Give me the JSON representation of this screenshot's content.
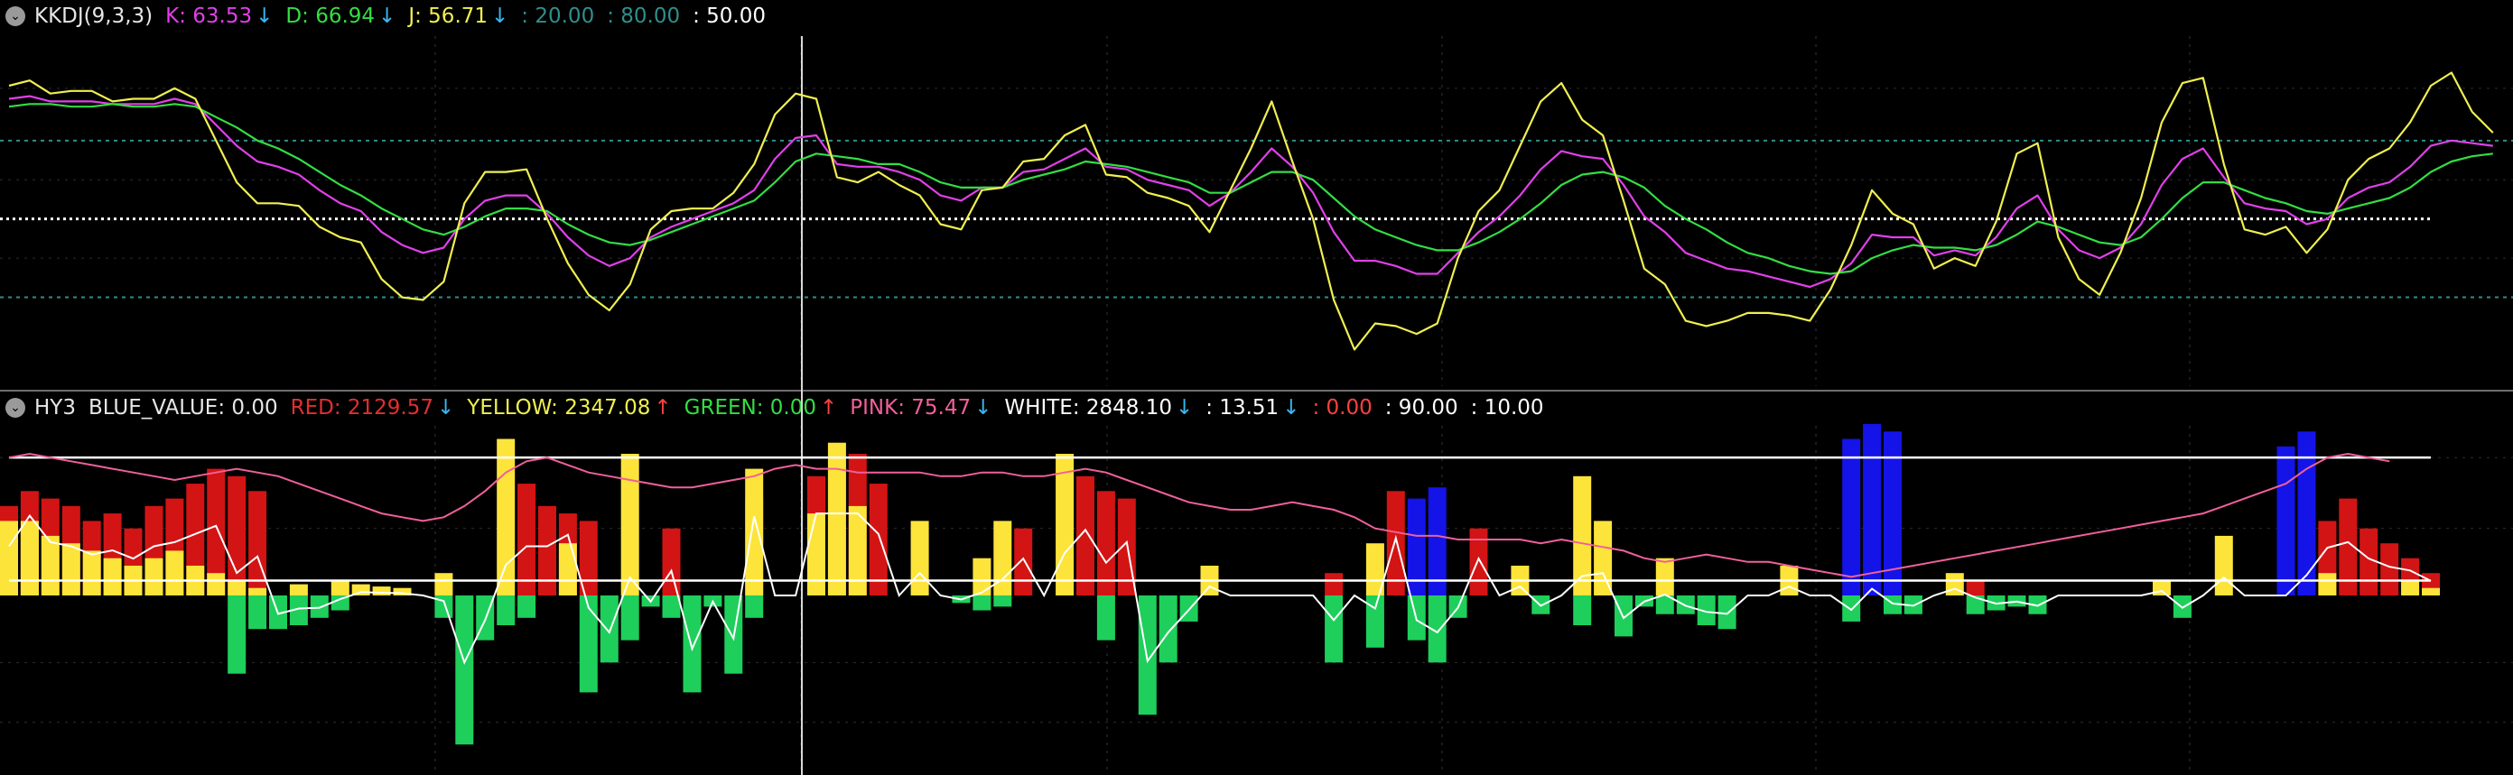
{
  "colors": {
    "k": "#e040ea",
    "d": "#33dd44",
    "j": "#f0ef50",
    "red": "#d31414",
    "yellow": "#fde43a",
    "green": "#1ecf5b",
    "blue": "#1414e8",
    "pink": "#f0609a",
    "white": "#ffffff",
    "teal": "#2f8f8c",
    "arrow_down": "#39b7ef",
    "arrow_up": "#ff4040"
  },
  "panel_top": {
    "title": "KKDJ(9,3,3)",
    "k_label": "K: 63.53",
    "k_dir": "↓",
    "d_label": "D: 66.94",
    "d_dir": "↓",
    "j_label": "J: 56.71",
    "j_dir": "↓",
    "level_low": ": 20.00",
    "level_high": ": 80.00",
    "level_mid": ": 50.00"
  },
  "panel_bottom": {
    "title": "HY3",
    "blue_label": "BLUE_VALUE: 0.00",
    "red_label": "RED: 2129.57",
    "red_dir": "↓",
    "yellow_label": "YELLOW: 2347.08",
    "yellow_dir": "↑",
    "green_label": "GREEN: 0.00",
    "green_dir": "↑",
    "pink_label": "PINK: 75.47",
    "pink_dir": "↓",
    "white_label": "WHITE: 2848.10",
    "white_dir": "↓",
    "v1_label": ": 13.51",
    "v1_dir": "↓",
    "v2_label": ": 0.00",
    "v3_label": ": 90.00",
    "v4_label": ": 10.00"
  },
  "chart_data": [
    {
      "type": "line",
      "title": "KKDJ(9,3,3)",
      "ylim": [
        -14,
        120
      ],
      "hlines": [
        {
          "value": 80,
          "style": "teal-dashed"
        },
        {
          "value": 50,
          "style": "white-dotted"
        },
        {
          "value": 20,
          "style": "teal-dashed"
        }
      ],
      "x_count": 118,
      "series": [
        {
          "name": "K",
          "color_key": "k",
          "values": [
            96,
            97,
            95,
            95,
            95,
            94,
            94,
            94,
            96,
            94,
            86,
            78,
            72,
            70,
            67,
            61,
            56,
            53,
            45,
            40,
            37,
            39,
            50,
            57,
            59,
            59,
            52,
            43,
            36,
            32,
            35,
            43,
            47,
            50,
            53,
            56,
            61,
            73,
            81,
            82,
            71,
            70,
            70,
            68,
            65,
            59,
            57,
            62,
            62,
            68,
            69,
            73,
            77,
            70,
            69,
            65,
            63,
            61,
            55,
            60,
            68,
            77,
            70,
            60,
            45,
            34,
            34,
            32,
            29,
            29,
            37,
            45,
            51,
            59,
            69,
            76,
            74,
            73,
            63,
            51,
            45,
            37,
            34,
            31,
            30,
            28,
            26,
            24,
            27,
            33,
            44,
            43,
            43,
            36,
            38,
            36,
            43,
            54,
            59,
            46,
            38,
            35,
            39,
            48,
            63,
            73,
            77,
            66,
            56,
            54,
            53,
            48,
            50,
            58,
            62,
            64,
            70,
            78,
            80,
            79,
            78
          ]
        },
        {
          "name": "D",
          "color_key": "d",
          "values": [
            93,
            94,
            94,
            93,
            93,
            94,
            93,
            93,
            94,
            93,
            89,
            85,
            80,
            77,
            73,
            68,
            63,
            59,
            54,
            50,
            46,
            44,
            47,
            51,
            54,
            54,
            53,
            48,
            44,
            41,
            40,
            42,
            45,
            48,
            51,
            54,
            57,
            64,
            72,
            75,
            74,
            73,
            71,
            71,
            68,
            64,
            62,
            62,
            62,
            65,
            67,
            69,
            72,
            71,
            70,
            68,
            66,
            64,
            60,
            60,
            64,
            68,
            68,
            65,
            58,
            51,
            46,
            43,
            40,
            38,
            38,
            41,
            45,
            50,
            56,
            63,
            67,
            68,
            66,
            62,
            55,
            50,
            46,
            41,
            37,
            35,
            32,
            30,
            29,
            30,
            35,
            38,
            40,
            39,
            39,
            38,
            40,
            44,
            49,
            47,
            44,
            41,
            40,
            43,
            50,
            58,
            64,
            64,
            61,
            58,
            56,
            53,
            52,
            54,
            56,
            58,
            62,
            68,
            72,
            74,
            75
          ]
        },
        {
          "name": "J",
          "color_key": "j",
          "values": [
            101,
            103,
            98,
            99,
            99,
            95,
            96,
            96,
            100,
            96,
            80,
            64,
            56,
            56,
            55,
            47,
            43,
            41,
            27,
            20,
            19,
            26,
            56,
            68,
            68,
            69,
            50,
            33,
            21,
            15,
            25,
            46,
            53,
            54,
            54,
            60,
            71,
            90,
            98,
            96,
            66,
            64,
            68,
            63,
            59,
            48,
            46,
            61,
            62,
            72,
            73,
            82,
            86,
            67,
            66,
            60,
            58,
            55,
            45,
            61,
            77,
            95,
            72,
            50,
            19,
            0,
            10,
            9,
            6,
            10,
            35,
            53,
            61,
            78,
            95,
            102,
            88,
            82,
            57,
            31,
            25,
            11,
            9,
            11,
            14,
            14,
            13,
            11,
            23,
            40,
            61,
            52,
            48,
            31,
            35,
            32,
            49,
            75,
            79,
            43,
            27,
            21,
            37,
            58,
            87,
            102,
            104,
            71,
            46,
            44,
            47,
            37,
            46,
            65,
            73,
            77,
            87,
            101,
            106,
            91,
            83
          ]
        }
      ]
    },
    {
      "type": "bar",
      "title": "HY3",
      "ylim": [
        -2300,
        2300
      ],
      "hlines": [
        {
          "value": 1850,
          "color_key": "white"
        },
        {
          "value": 200,
          "color_key": "white"
        }
      ],
      "x_count": 118,
      "red_values": [
        1200,
        1400,
        1300,
        1200,
        1000,
        1100,
        900,
        1200,
        1300,
        1500,
        1700,
        1600,
        1400,
        0,
        0,
        0,
        0,
        0,
        0,
        0,
        0,
        0,
        0,
        0,
        0,
        1500,
        1200,
        1100,
        1000,
        0,
        0,
        0,
        900,
        0,
        0,
        0,
        1300,
        0,
        0,
        1600,
        1900,
        1900,
        1500,
        0,
        0,
        0,
        0,
        0,
        0,
        900,
        0,
        0,
        1600,
        1400,
        1300,
        0,
        0,
        0,
        0,
        0,
        0,
        0,
        0,
        0,
        300,
        0,
        0,
        1400,
        0,
        0,
        0,
        900,
        0,
        0,
        0,
        0,
        0,
        0,
        0,
        0,
        0,
        0,
        0,
        0,
        0,
        0,
        0,
        0,
        0,
        0,
        0,
        0,
        0,
        0,
        0,
        200,
        0,
        0,
        0,
        0,
        0,
        0,
        0,
        0,
        0,
        0,
        0,
        0,
        0,
        0,
        0,
        500,
        1000,
        1300,
        900,
        700,
        500,
        300
      ],
      "yellow_values": [
        1000,
        900,
        800,
        700,
        600,
        500,
        400,
        500,
        600,
        400,
        300,
        200,
        100,
        0,
        0,
        0,
        0,
        0,
        0,
        0,
        0,
        0,
        0,
        0,
        0,
        0,
        0,
        0,
        0,
        0,
        0,
        0,
        0,
        0,
        0,
        0,
        0,
        0,
        0,
        0,
        0,
        0,
        0,
        0,
        0,
        0,
        0,
        0,
        0,
        0,
        0,
        0,
        0,
        0,
        0,
        0,
        0,
        0,
        0,
        0,
        0,
        0,
        0,
        0,
        0,
        0,
        0,
        0,
        0,
        0,
        0,
        0,
        0,
        0,
        0,
        0,
        0,
        0,
        0,
        0,
        0,
        0,
        0,
        0,
        0,
        0,
        0,
        0,
        0,
        0,
        0,
        0,
        0,
        0,
        0,
        0,
        0,
        0,
        0,
        0,
        0,
        0,
        0,
        0,
        0,
        0,
        0,
        0,
        0,
        0,
        0,
        0,
        0,
        0,
        0,
        0,
        0,
        0
      ],
      "yellow_bars": [
        0,
        1000,
        0,
        0,
        0,
        0,
        0,
        0,
        0,
        0,
        0,
        0,
        0,
        0,
        150,
        0,
        200,
        150,
        120,
        100,
        0,
        300,
        0,
        0,
        2100,
        0,
        0,
        700,
        0,
        0,
        1900,
        0,
        0,
        0,
        0,
        0,
        1700,
        0,
        0,
        1100,
        2050,
        1200,
        0,
        0,
        1000,
        0,
        0,
        500,
        1000,
        0,
        0,
        1900,
        0,
        0,
        0,
        0,
        0,
        0,
        400,
        0,
        0,
        0,
        0,
        0,
        0,
        0,
        700,
        0,
        0,
        0,
        0,
        0,
        0,
        400,
        0,
        0,
        1600,
        1000,
        0,
        0,
        500,
        0,
        0,
        0,
        0,
        0,
        400,
        0,
        0,
        0,
        300,
        100,
        0,
        0,
        300,
        0,
        0,
        0,
        0,
        0,
        0,
        0,
        0,
        0,
        200,
        0,
        0,
        800,
        0,
        0,
        0,
        0,
        300,
        0,
        0,
        0,
        200,
        100,
        0,
        0,
        0,
        0,
        250,
        200,
        100
      ],
      "green_values": [
        0,
        0,
        0,
        0,
        0,
        0,
        0,
        0,
        0,
        0,
        0,
        -1050,
        -450,
        -450,
        -400,
        -300,
        -200,
        0,
        0,
        0,
        0,
        -300,
        -2000,
        -600,
        -400,
        -300,
        0,
        0,
        -1300,
        -900,
        -600,
        -150,
        -300,
        -1300,
        -150,
        -1050,
        -300,
        0,
        0,
        0,
        0,
        0,
        0,
        0,
        0,
        0,
        -100,
        -200,
        -150,
        0,
        0,
        0,
        0,
        -600,
        0,
        -1600,
        -900,
        -350,
        0,
        0,
        0,
        0,
        0,
        0,
        -900,
        0,
        -700,
        0,
        -600,
        -900,
        -300,
        0,
        0,
        0,
        -250,
        0,
        -400,
        0,
        -550,
        -150,
        -250,
        -250,
        -400,
        -450,
        0,
        0,
        0,
        0,
        0,
        -350,
        0,
        -250,
        -250,
        0,
        0,
        -250,
        -200,
        -150,
        -250,
        0,
        0,
        0,
        0,
        0,
        0,
        -300
      ],
      "blue_values": [
        0,
        0,
        0,
        0,
        0,
        0,
        0,
        0,
        0,
        0,
        0,
        0,
        0,
        0,
        0,
        0,
        0,
        0,
        0,
        0,
        0,
        0,
        0,
        0,
        0,
        0,
        0,
        0,
        0,
        0,
        0,
        0,
        0,
        0,
        0,
        0,
        0,
        0,
        0,
        0,
        0,
        0,
        0,
        0,
        0,
        0,
        0,
        0,
        0,
        0,
        0,
        0,
        0,
        0,
        0,
        0,
        0,
        0,
        0,
        0,
        0,
        0,
        0,
        0,
        0,
        0,
        0,
        0,
        1300,
        1450,
        0,
        0,
        0,
        0,
        0,
        0,
        0,
        0,
        0,
        0,
        0,
        0,
        0,
        0,
        0,
        0,
        0,
        0,
        0,
        2100,
        2300,
        2200,
        0,
        0,
        0,
        0,
        0,
        0,
        0,
        0,
        0,
        0,
        0,
        0,
        0,
        0,
        0,
        0,
        0,
        0,
        2000,
        2200,
        0,
        0,
        0,
        0,
        0,
        0,
        0,
        0,
        0,
        0,
        0,
        0,
        0,
        0,
        0,
        0,
        0,
        0
      ],
      "pink_line": [
        1850,
        1900,
        1850,
        1800,
        1750,
        1700,
        1650,
        1600,
        1550,
        1600,
        1650,
        1700,
        1650,
        1600,
        1500,
        1400,
        1300,
        1200,
        1100,
        1050,
        1000,
        1050,
        1200,
        1400,
        1650,
        1800,
        1850,
        1750,
        1650,
        1600,
        1550,
        1500,
        1450,
        1450,
        1500,
        1550,
        1600,
        1700,
        1750,
        1700,
        1700,
        1650,
        1650,
        1650,
        1650,
        1600,
        1600,
        1650,
        1650,
        1600,
        1600,
        1650,
        1700,
        1650,
        1550,
        1450,
        1350,
        1250,
        1200,
        1150,
        1150,
        1200,
        1250,
        1200,
        1150,
        1050,
        900,
        850,
        800,
        800,
        750,
        750,
        750,
        750,
        700,
        750,
        700,
        650,
        600,
        500,
        450,
        500,
        550,
        500,
        450,
        450,
        400,
        350,
        300,
        250,
        300,
        350,
        400,
        450,
        500,
        550,
        600,
        650,
        700,
        750,
        800,
        850,
        900,
        950,
        1000,
        1050,
        1100,
        1200,
        1300,
        1400,
        1500,
        1700,
        1850,
        1900,
        1850,
        1800
      ]
    }
  ]
}
